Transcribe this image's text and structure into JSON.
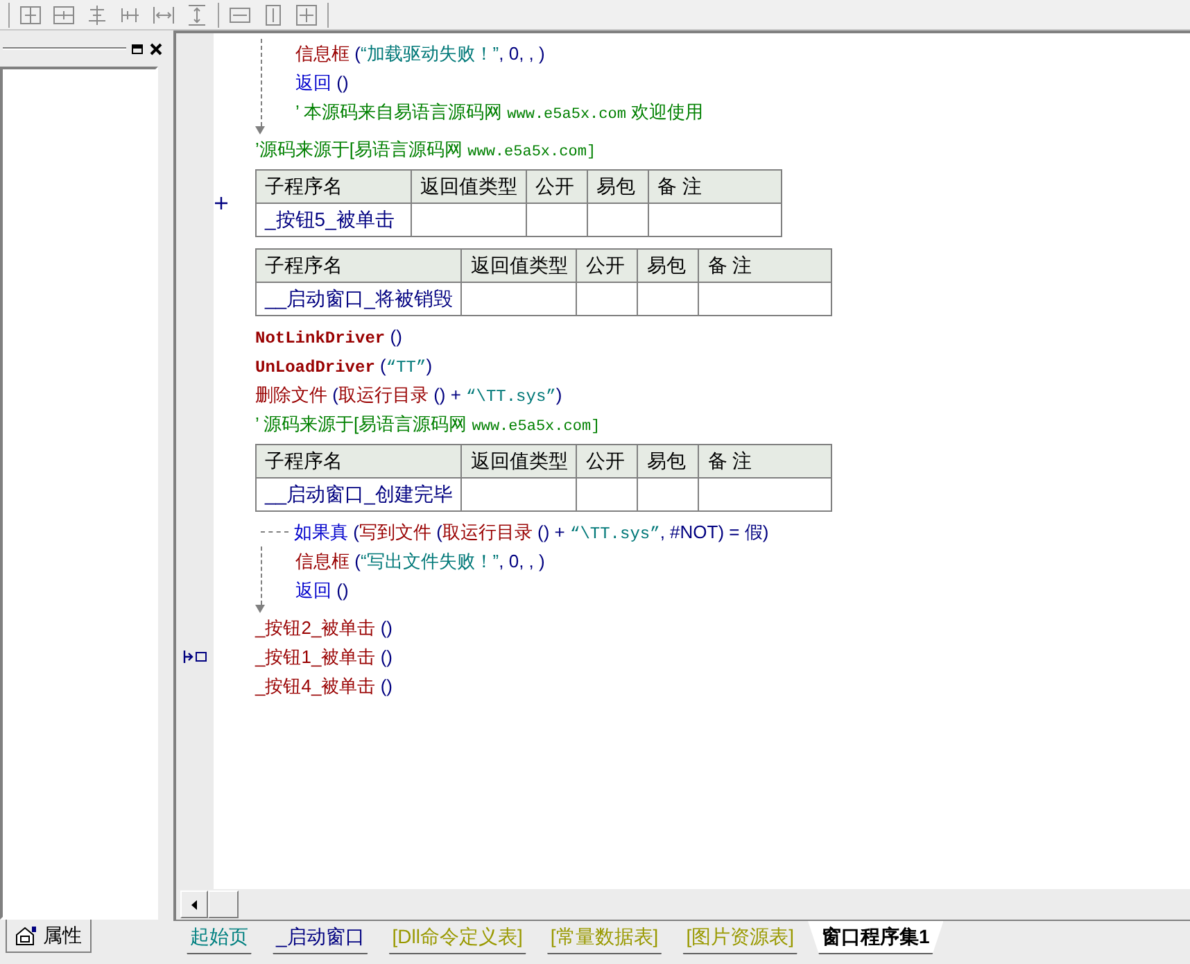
{
  "code": [
    {
      "kind": "block",
      "children": [
        {
          "kind": "line",
          "tokens": [
            {
              "text": "信息框",
              "kind": "command"
            },
            {
              "text": " (",
              "kind": "punct"
            },
            {
              "text": "“加载驱动失败！”",
              "kind": "string"
            },
            {
              "text": ", 0, , )",
              "kind": "punct"
            }
          ]
        },
        {
          "kind": "line",
          "tokens": [
            {
              "text": "返回",
              "kind": "flow"
            },
            {
              "text": " ()",
              "kind": "punct"
            }
          ]
        },
        {
          "kind": "line",
          "tokens": [
            {
              "text": "’ 本源码来自易语言源码网 ",
              "kind": "comment"
            },
            {
              "text": "www.e5a5x.com",
              "kind": "comment_mono"
            },
            {
              "text": "  欢迎使用",
              "kind": "comment"
            }
          ]
        }
      ]
    },
    {
      "kind": "line",
      "tokens": [
        {
          "text": "’源码来源于[易语言源码网 ",
          "kind": "comment"
        },
        {
          "text": "www.e5a5x.com]",
          "kind": "comment_mono"
        }
      ]
    },
    {
      "kind": "table",
      "collapsed": true,
      "columns": [
        "子程序名",
        "返回值类型",
        "公开",
        "易包",
        "备 注"
      ],
      "name": "_按钮5_被单击"
    },
    {
      "kind": "table",
      "collapsed": false,
      "columns": [
        "子程序名",
        "返回值类型",
        "公开",
        "易包",
        "备 注"
      ],
      "name": "__启动窗口_将被销毁"
    },
    {
      "kind": "line",
      "tokens": [
        {
          "text": "NotLinkDriver",
          "kind": "command_latin"
        },
        {
          "text": " ()",
          "kind": "punct"
        }
      ]
    },
    {
      "kind": "line",
      "tokens": [
        {
          "text": "UnLoadDriver",
          "kind": "command_latin"
        },
        {
          "text": " (",
          "kind": "punct"
        },
        {
          "text": "“TT”",
          "kind": "string_mono"
        },
        {
          "text": ")",
          "kind": "punct"
        }
      ]
    },
    {
      "kind": "line",
      "tokens": [
        {
          "text": "删除文件",
          "kind": "command"
        },
        {
          "text": " (",
          "kind": "punct"
        },
        {
          "text": "取运行目录",
          "kind": "command"
        },
        {
          "text": " () + ",
          "kind": "punct"
        },
        {
          "text": "“\\TT.sys”",
          "kind": "string_mono"
        },
        {
          "text": ")",
          "kind": "punct"
        }
      ]
    },
    {
      "kind": "line",
      "tokens": [
        {
          "text": "’ 源码来源于[易语言源码网 ",
          "kind": "comment"
        },
        {
          "text": "www.e5a5x.com]",
          "kind": "comment_mono"
        }
      ]
    },
    {
      "kind": "table",
      "collapsed": false,
      "columns": [
        "子程序名",
        "返回值类型",
        "公开",
        "易包",
        "备 注"
      ],
      "name": "__启动窗口_创建完毕"
    },
    {
      "kind": "if",
      "tokens": [
        {
          "text": "如果真",
          "kind": "flow"
        },
        {
          "text": " (",
          "kind": "punct"
        },
        {
          "text": "写到文件",
          "kind": "command"
        },
        {
          "text": " (",
          "kind": "punct"
        },
        {
          "text": "取运行目录",
          "kind": "command"
        },
        {
          "text": " () + ",
          "kind": "punct"
        },
        {
          "text": "“\\TT.sys”",
          "kind": "string_mono"
        },
        {
          "text": ", #NOT) = 假)",
          "kind": "punct"
        }
      ],
      "children": [
        {
          "kind": "line",
          "tokens": [
            {
              "text": "信息框",
              "kind": "command"
            },
            {
              "text": " (",
              "kind": "punct"
            },
            {
              "text": "“写出文件失败！”",
              "kind": "string"
            },
            {
              "text": ", 0, , )",
              "kind": "punct"
            }
          ]
        },
        {
          "kind": "line",
          "tokens": [
            {
              "text": "返回",
              "kind": "flow"
            },
            {
              "text": " ()",
              "kind": "punct"
            }
          ]
        }
      ]
    },
    {
      "kind": "line",
      "tokens": [
        {
          "text": "_按钮2_被单击",
          "kind": "command"
        },
        {
          "text": " ()",
          "kind": "punct"
        }
      ]
    },
    {
      "kind": "line",
      "current": true,
      "tokens": [
        {
          "text": "_按钮1_被单击",
          "kind": "command"
        },
        {
          "text": " ()",
          "kind": "punct"
        }
      ]
    },
    {
      "kind": "line",
      "tokens": [
        {
          "text": "_按钮4_被单击",
          "kind": "command"
        },
        {
          "text": " ()",
          "kind": "punct"
        }
      ]
    }
  ],
  "side_tab": {
    "label": "属性"
  },
  "tabs": [
    {
      "label": "起始页",
      "color": "#008080",
      "selected": false
    },
    {
      "label": "_启动窗口",
      "color": "#000080",
      "selected": false
    },
    {
      "label": "[Dll命令定义表]",
      "color": "#999900",
      "selected": false
    },
    {
      "label": "[常量数据表]",
      "color": "#999900",
      "selected": false
    },
    {
      "label": "[图片资源表]",
      "color": "#999900",
      "selected": false
    },
    {
      "label": "窗口程序集1",
      "color": "#000000",
      "selected": true
    }
  ]
}
